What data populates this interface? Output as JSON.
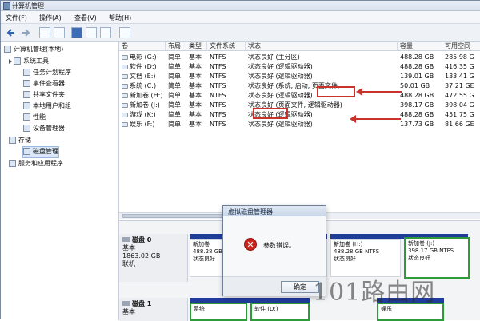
{
  "window": {
    "title": "计算机管理"
  },
  "menu": [
    "文件(F)",
    "操作(A)",
    "查看(V)",
    "帮助(H)"
  ],
  "tree": [
    {
      "label": "计算机管理(本地)",
      "level": 0
    },
    {
      "label": "系统工具",
      "level": 1
    },
    {
      "label": "任务计划程序",
      "level": 2
    },
    {
      "label": "事件查看器",
      "level": 2
    },
    {
      "label": "共享文件夹",
      "level": 2
    },
    {
      "label": "本地用户和组",
      "level": 2
    },
    {
      "label": "性能",
      "level": 2
    },
    {
      "label": "设备管理器",
      "level": 2
    },
    {
      "label": "存储",
      "level": 1
    },
    {
      "label": "磁盘管理",
      "level": 2,
      "selected": true
    },
    {
      "label": "服务和应用程序",
      "level": 1
    }
  ],
  "columns": [
    "卷",
    "布局",
    "类型",
    "文件系统",
    "状态",
    "容量",
    "可用空间"
  ],
  "volumes": [
    {
      "name": "电影 (G:)",
      "layout": "简单",
      "type": "基本",
      "fs": "NTFS",
      "status": "状态良好 (主分区)",
      "capacity": "488.28 GB",
      "free": "285.98 G"
    },
    {
      "name": "软件 (D:)",
      "layout": "简单",
      "type": "基本",
      "fs": "NTFS",
      "status": "状态良好 (逻辑驱动器)",
      "capacity": "488.28 GB",
      "free": "416.35 G"
    },
    {
      "name": "文档 (E:)",
      "layout": "简单",
      "type": "基本",
      "fs": "NTFS",
      "status": "状态良好 (逻辑驱动器)",
      "capacity": "139.01 GB",
      "free": "133.41 G"
    },
    {
      "name": "系统 (C:)",
      "layout": "简单",
      "type": "基本",
      "fs": "NTFS",
      "status": "状态良好 (系统, 启动, 页面文件,",
      "capacity": "50.01 GB",
      "free": "37.21 GE"
    },
    {
      "name": "新加卷 (H:)",
      "layout": "简单",
      "type": "基本",
      "fs": "NTFS",
      "status": "状态良好 (逻辑驱动器)",
      "capacity": "488.28 GB",
      "free": "472.55 G"
    },
    {
      "name": "新加卷 (J:)",
      "layout": "简单",
      "type": "基本",
      "fs": "NTFS",
      "status": "状态良好 (页面文件, 逻辑驱动器)",
      "capacity": "398.17 GB",
      "free": "398.04 G"
    },
    {
      "name": "游戏 (K:)",
      "layout": "简单",
      "type": "基本",
      "fs": "NTFS",
      "status": "状态良好 (逻辑驱动器)",
      "capacity": "488.28 GB",
      "free": "451.75 G"
    },
    {
      "name": "娱乐 (F:)",
      "layout": "简单",
      "type": "基本",
      "fs": "NTFS",
      "status": "状态良好 (逻辑驱动器)",
      "capacity": "137.73 GB",
      "free": "81.66 GE"
    }
  ],
  "callout": {
    "text": "页面文件,"
  },
  "disks": [
    {
      "name": "磁盘 0",
      "type": "基本",
      "size": "1863.02 GB",
      "state": "联机"
    },
    {
      "name": "磁盘 1",
      "type": "基本"
    }
  ],
  "disk0_parts": [
    {
      "name": "新加卷",
      "size": "488.28 GB",
      "status": "状态良好"
    },
    {
      "name": "新加卷 (H:)",
      "size": "488.28 GB NTFS",
      "status": "状态良好"
    },
    {
      "name": "新加卷 (J:)",
      "size": "398.17 GB NTFS",
      "status": "状态良好"
    }
  ],
  "disk1_parts": [
    {
      "name": "系统"
    },
    {
      "name": "软件 (D:)"
    },
    {
      "name": "娱乐"
    }
  ],
  "dialog": {
    "title": "虚拟磁盘管理器",
    "message": "参数错误。",
    "ok": "确定",
    "icon": "error-icon"
  },
  "watermark": "101路由网"
}
